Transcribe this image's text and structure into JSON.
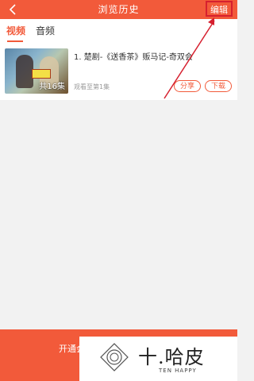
{
  "header": {
    "title": "浏览历史",
    "edit_label": "编辑",
    "back_icon": "chevron-left-icon"
  },
  "tabs": [
    {
      "label": "视频",
      "active": true
    },
    {
      "label": "音频",
      "active": false
    }
  ],
  "history_item": {
    "title": "1. 楚剧-《送香茶》贩马记-奇双会",
    "episode_count": "共16集",
    "progress": "观看至第1集",
    "share_label": "分享",
    "download_label": "下载"
  },
  "bottom_bar": {
    "text": "开通会"
  },
  "watermark": {
    "cn": "十.哈皮",
    "en": "TEN HAPPY"
  },
  "colors": {
    "accent": "#f25a3a",
    "highlight": "#d6202f"
  }
}
